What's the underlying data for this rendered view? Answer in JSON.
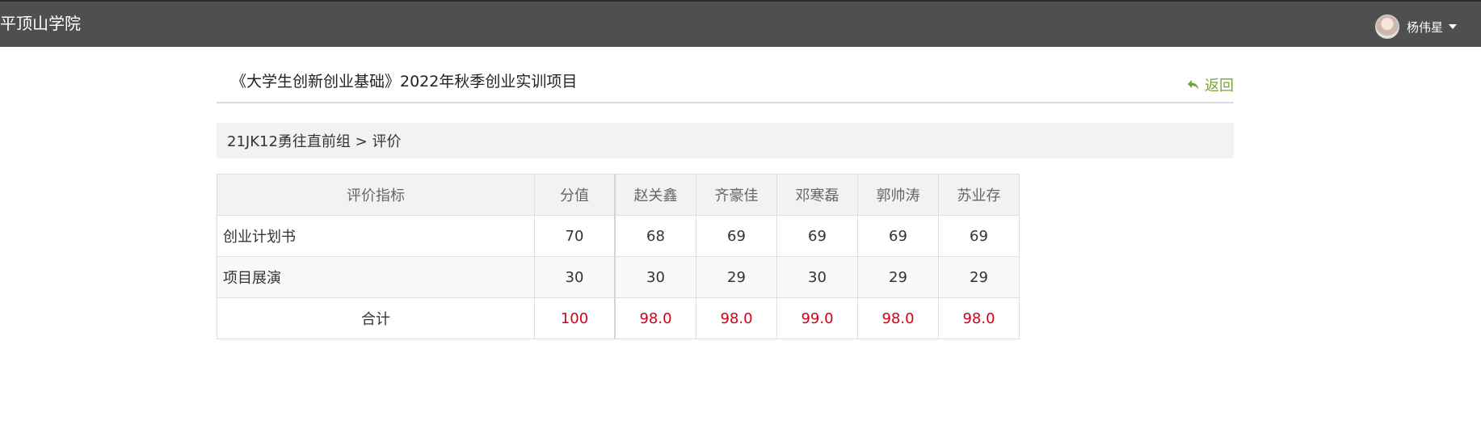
{
  "header": {
    "brand": "平顶山学院",
    "user_name": "杨伟星"
  },
  "page": {
    "title": "《大学生创新创业基础》2022年秋季创业实训项目",
    "back_label": "返回",
    "breadcrumb": "21JK12勇往直前组 > 评价"
  },
  "table": {
    "headers": [
      "评价指标",
      "分值",
      "赵关鑫",
      "齐豪佳",
      "邓寒磊",
      "郭帅涛",
      "苏业存"
    ],
    "rows": [
      {
        "indicator": "创业计划书",
        "value": "70",
        "scores": [
          "68",
          "69",
          "69",
          "69",
          "69"
        ]
      },
      {
        "indicator": "项目展演",
        "value": "30",
        "scores": [
          "30",
          "29",
          "30",
          "29",
          "29"
        ]
      }
    ],
    "total": {
      "label": "合计",
      "value": "100",
      "scores": [
        "98.0",
        "98.0",
        "99.0",
        "98.0",
        "98.0"
      ]
    }
  },
  "colors": {
    "topbar": "#4f4f4f",
    "accent_green": "#77a43a",
    "total_red": "#d0021b"
  }
}
